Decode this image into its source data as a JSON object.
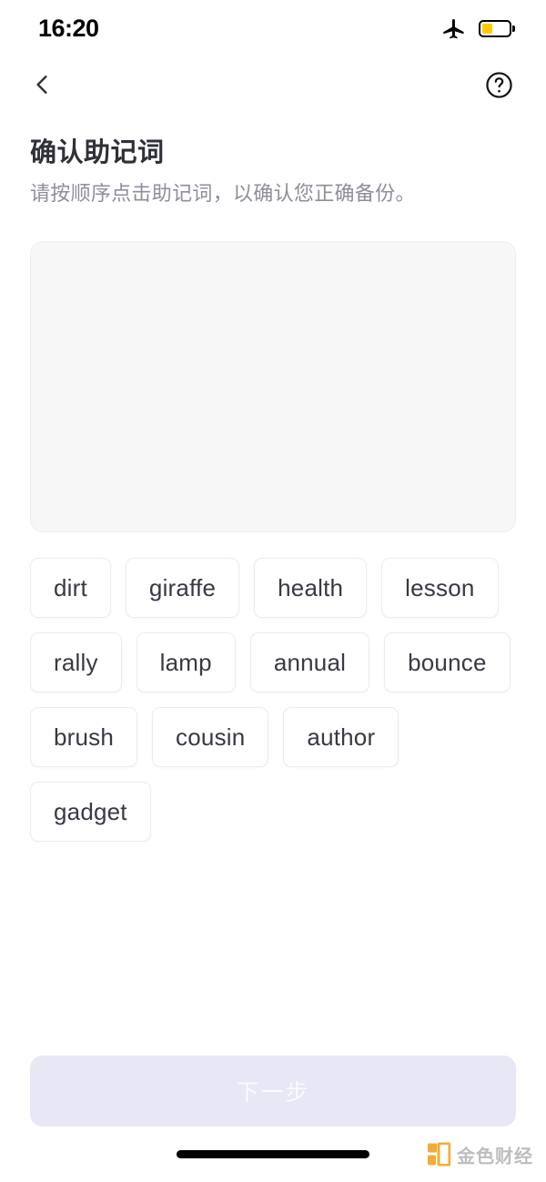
{
  "status_bar": {
    "time": "16:20",
    "airplane_icon": "airplane-mode-icon",
    "battery_icon": "battery-low-power-icon",
    "battery_level_percent": 40,
    "battery_color": "#FFCB00"
  },
  "nav": {
    "back_icon": "chevron-left-icon",
    "help_icon": "question-mark-circle-icon"
  },
  "heading": {
    "title": "确认助记词",
    "subtitle": "请按顺序点击助记词，以确认您正确备份。"
  },
  "dropzone": {
    "selected_words": [],
    "background": "#f7f7f8"
  },
  "word_pool": {
    "words": [
      "dirt",
      "giraffe",
      "health",
      "lesson",
      "rally",
      "lamp",
      "annual",
      "bounce",
      "brush",
      "cousin",
      "author",
      "gadget"
    ]
  },
  "footer": {
    "next_label": "下一步",
    "next_disabled": true,
    "next_background": "#e7e7f5"
  },
  "watermark": {
    "text": "金色财经",
    "mark_color": "#F5A623"
  }
}
